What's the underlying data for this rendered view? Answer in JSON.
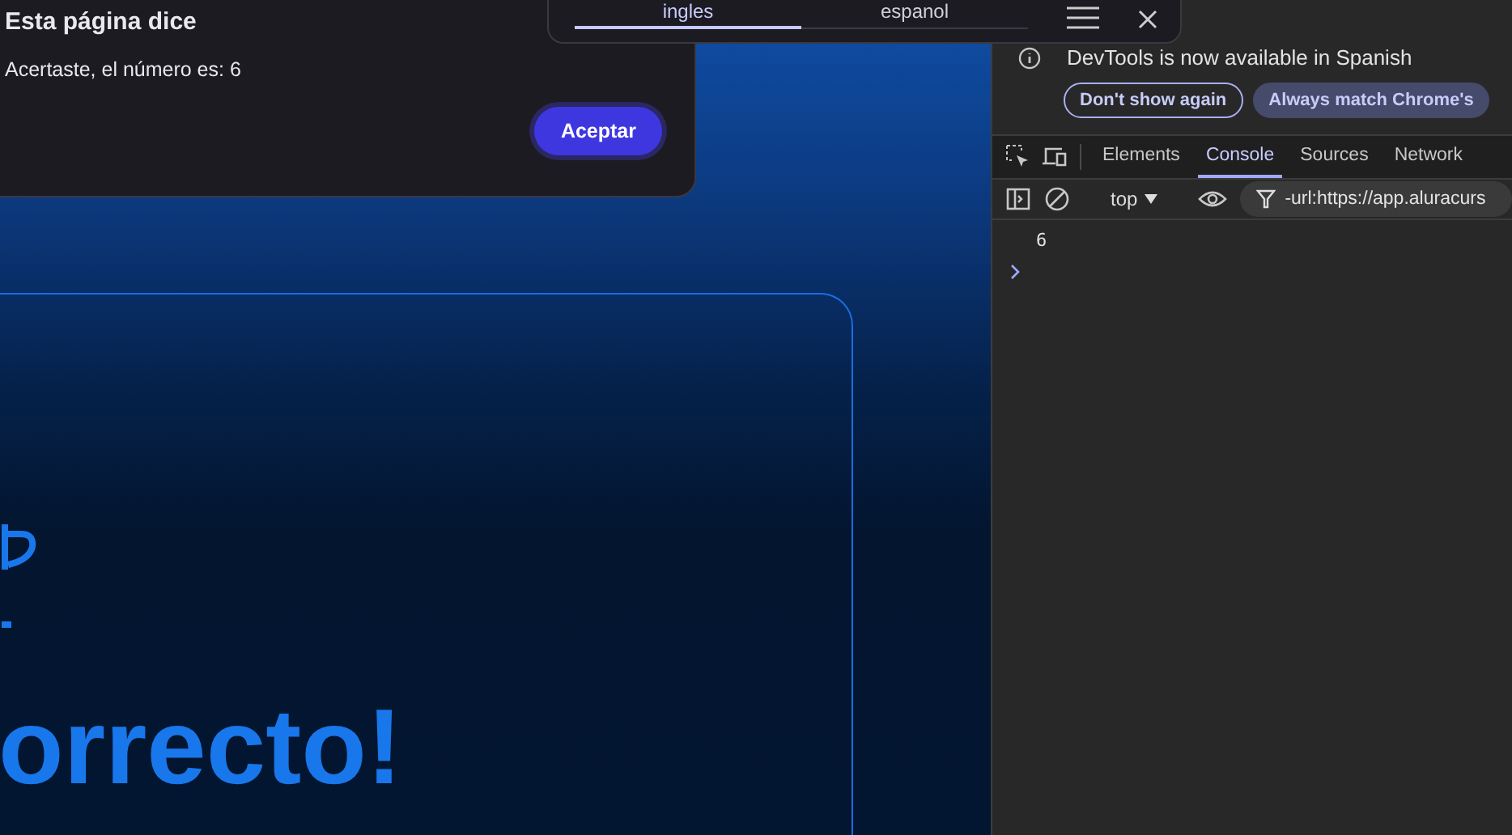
{
  "translate_popup": {
    "tabs": [
      {
        "label": "ingles",
        "selected": true
      },
      {
        "label": "espanol",
        "selected": false
      }
    ]
  },
  "alert_dialog": {
    "title": "Esta página dice",
    "message": "Acertaste, el número es: 6",
    "button": "Aceptar"
  },
  "page_card": {
    "heading": "orrecto!"
  },
  "devtools": {
    "notice": {
      "text": "DevTools is now available in Spanish",
      "buttons": [
        "Don't show again",
        "Always match Chrome's"
      ]
    },
    "tabs": [
      {
        "label": "Elements",
        "selected": false
      },
      {
        "label": "Console",
        "selected": true
      },
      {
        "label": "Sources",
        "selected": false
      },
      {
        "label": "Network",
        "selected": false
      }
    ],
    "context": "top",
    "filter": "-url:https://app.aluracurs",
    "console_lines": [
      "6"
    ]
  }
}
